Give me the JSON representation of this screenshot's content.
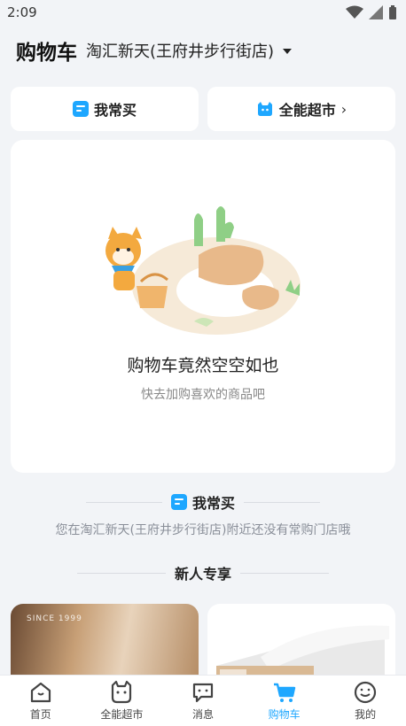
{
  "status": {
    "time": "2:09"
  },
  "header": {
    "title": "购物车",
    "store": "淘汇新天(王府井步行街店)"
  },
  "quick": {
    "frequent": "我常买",
    "supermarket": "全能超市",
    "chevron": "›"
  },
  "empty": {
    "title": "购物车竟然空空如也",
    "subtitle": "快去加购喜欢的商品吧"
  },
  "frequent_section": {
    "label": "我常买",
    "notice": "您在淘汇新天(王府井步行街店)附近还没有常购门店哦"
  },
  "newuser_section": {
    "label": "新人专享"
  },
  "promos": [
    {
      "tag": "SINCE 1999"
    },
    {
      "tag": ""
    }
  ],
  "tabs": [
    {
      "label": "首页",
      "icon": "home-icon",
      "active": false
    },
    {
      "label": "全能超市",
      "icon": "cat-icon",
      "active": false
    },
    {
      "label": "消息",
      "icon": "message-icon",
      "active": false
    },
    {
      "label": "购物车",
      "icon": "cart-icon",
      "active": true
    },
    {
      "label": "我的",
      "icon": "smile-icon",
      "active": false
    }
  ],
  "colors": {
    "accent": "#1ea7ff",
    "background": "#f2f4f7"
  }
}
